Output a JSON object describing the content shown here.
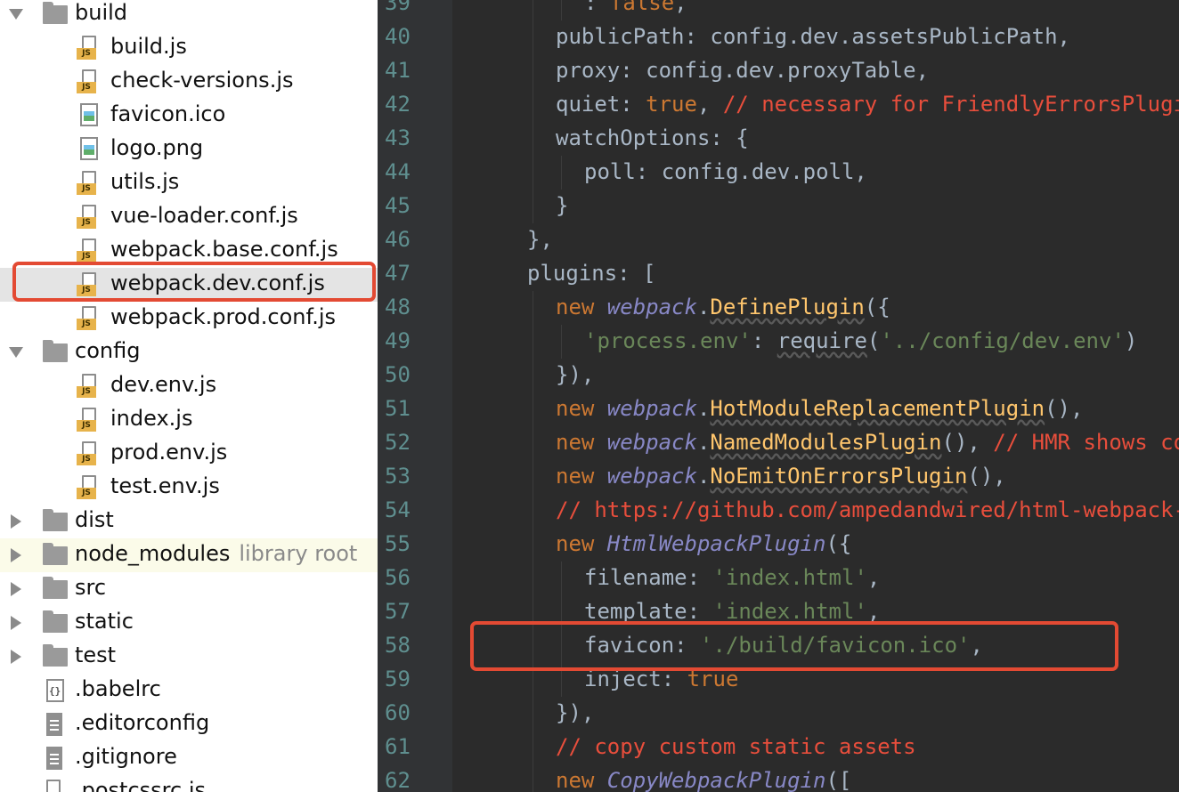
{
  "project_tree": {
    "items": [
      {
        "type": "folder",
        "label": "build",
        "expanded": true,
        "depth": 0
      },
      {
        "type": "js",
        "label": "build.js",
        "depth": 1
      },
      {
        "type": "js",
        "label": "check-versions.js",
        "depth": 1
      },
      {
        "type": "image",
        "label": "favicon.ico",
        "depth": 1
      },
      {
        "type": "image",
        "label": "logo.png",
        "depth": 1
      },
      {
        "type": "js",
        "label": "utils.js",
        "depth": 1
      },
      {
        "type": "js",
        "label": "vue-loader.conf.js",
        "depth": 1
      },
      {
        "type": "js",
        "label": "webpack.base.conf.js",
        "depth": 1
      },
      {
        "type": "js",
        "label": "webpack.dev.conf.js",
        "depth": 1,
        "selected": true
      },
      {
        "type": "js",
        "label": "webpack.prod.conf.js",
        "depth": 1
      },
      {
        "type": "folder",
        "label": "config",
        "expanded": true,
        "depth": 0
      },
      {
        "type": "js",
        "label": "dev.env.js",
        "depth": 1
      },
      {
        "type": "js",
        "label": "index.js",
        "depth": 1
      },
      {
        "type": "js",
        "label": "prod.env.js",
        "depth": 1
      },
      {
        "type": "js",
        "label": "test.env.js",
        "depth": 1
      },
      {
        "type": "folder",
        "label": "dist",
        "expanded": false,
        "depth": 0
      },
      {
        "type": "folder",
        "label": "node_modules",
        "expanded": false,
        "depth": 0,
        "suffix": "library root"
      },
      {
        "type": "folder",
        "label": "src",
        "expanded": false,
        "depth": 0
      },
      {
        "type": "folder",
        "label": "static",
        "expanded": false,
        "depth": 0
      },
      {
        "type": "folder",
        "label": "test",
        "expanded": false,
        "depth": 0
      },
      {
        "type": "config",
        "label": ".babelrc",
        "depth": 0
      },
      {
        "type": "text",
        "label": ".editorconfig",
        "depth": 0
      },
      {
        "type": "text",
        "label": ".gitignore",
        "depth": 0
      },
      {
        "type": "js",
        "label": ".postcssrc.js",
        "depth": 0
      }
    ]
  },
  "editor": {
    "lines": [
      {
        "n": "39",
        "indent": 2,
        "tokens": [
          [
            "p",
            ": "
          ],
          [
            "k",
            "false"
          ],
          [
            "p",
            ","
          ]
        ]
      },
      {
        "n": "40",
        "indent": 1,
        "tokens": [
          [
            "p",
            "publicPath: config.dev.assetsPublicPath,"
          ]
        ]
      },
      {
        "n": "41",
        "indent": 1,
        "tokens": [
          [
            "p",
            "proxy: config.dev.proxyTable,"
          ]
        ]
      },
      {
        "n": "42",
        "indent": 1,
        "tokens": [
          [
            "p",
            "quiet: "
          ],
          [
            "k",
            "true"
          ],
          [
            "p",
            ", "
          ],
          [
            "c",
            "// necessary for FriendlyErrorsPlugin"
          ]
        ]
      },
      {
        "n": "43",
        "indent": 1,
        "tokens": [
          [
            "p",
            "watchOptions: {"
          ]
        ]
      },
      {
        "n": "44",
        "indent": 2,
        "tokens": [
          [
            "p",
            "poll: config.dev.poll,"
          ]
        ]
      },
      {
        "n": "45",
        "indent": 1,
        "tokens": [
          [
            "p",
            "}"
          ]
        ]
      },
      {
        "n": "46",
        "indent": 0,
        "tokens": [
          [
            "p",
            "},"
          ]
        ]
      },
      {
        "n": "47",
        "indent": 0,
        "tokens": [
          [
            "p",
            "plugins: ["
          ]
        ]
      },
      {
        "n": "48",
        "indent": 1,
        "tokens": [
          [
            "k",
            "new "
          ],
          [
            "i",
            "webpack"
          ],
          [
            "p",
            "."
          ],
          [
            "fu",
            "DefinePlugin"
          ],
          [
            "p",
            "({"
          ]
        ]
      },
      {
        "n": "49",
        "indent": 2,
        "tokens": [
          [
            "s",
            "'process.env'"
          ],
          [
            "p",
            ": "
          ],
          [
            "pu",
            "require"
          ],
          [
            "p",
            "("
          ],
          [
            "s",
            "'../config/dev.env'"
          ],
          [
            "p",
            ")"
          ]
        ]
      },
      {
        "n": "50",
        "indent": 1,
        "tokens": [
          [
            "p",
            "}),"
          ]
        ]
      },
      {
        "n": "51",
        "indent": 1,
        "tokens": [
          [
            "k",
            "new "
          ],
          [
            "i",
            "webpack"
          ],
          [
            "p",
            "."
          ],
          [
            "fu",
            "HotModuleReplacementPlugin"
          ],
          [
            "p",
            "(),"
          ]
        ]
      },
      {
        "n": "52",
        "indent": 1,
        "tokens": [
          [
            "k",
            "new "
          ],
          [
            "i",
            "webpack"
          ],
          [
            "p",
            "."
          ],
          [
            "fu",
            "NamedModulesPlugin"
          ],
          [
            "p",
            "(), "
          ],
          [
            "c",
            "// HMR shows correct file names in console on update."
          ]
        ]
      },
      {
        "n": "53",
        "indent": 1,
        "tokens": [
          [
            "k",
            "new "
          ],
          [
            "i",
            "webpack"
          ],
          [
            "p",
            "."
          ],
          [
            "fu",
            "NoEmitOnErrorsPlugin"
          ],
          [
            "p",
            "(),"
          ]
        ]
      },
      {
        "n": "54",
        "indent": 1,
        "tokens": [
          [
            "c",
            "// https://github.com/ampedandwired/html-webpack-plugin"
          ]
        ]
      },
      {
        "n": "55",
        "indent": 1,
        "tokens": [
          [
            "k",
            "new "
          ],
          [
            "i",
            "HtmlWebpackPlugin"
          ],
          [
            "p",
            "({"
          ]
        ]
      },
      {
        "n": "56",
        "indent": 2,
        "tokens": [
          [
            "p",
            "filename: "
          ],
          [
            "s",
            "'index.html'"
          ],
          [
            "p",
            ","
          ]
        ]
      },
      {
        "n": "57",
        "indent": 2,
        "tokens": [
          [
            "p",
            "template: "
          ],
          [
            "s",
            "'index.html'"
          ],
          [
            "p",
            ","
          ]
        ]
      },
      {
        "n": "58",
        "indent": 2,
        "tokens": [
          [
            "p",
            "favicon: "
          ],
          [
            "s",
            "'./build/favicon.ico'"
          ],
          [
            "p",
            ","
          ]
        ]
      },
      {
        "n": "59",
        "indent": 2,
        "tokens": [
          [
            "p",
            "inject: "
          ],
          [
            "k",
            "true"
          ]
        ]
      },
      {
        "n": "60",
        "indent": 1,
        "tokens": [
          [
            "p",
            "}),"
          ]
        ]
      },
      {
        "n": "61",
        "indent": 1,
        "tokens": [
          [
            "c",
            "// copy custom static assets"
          ]
        ]
      },
      {
        "n": "62",
        "indent": 1,
        "tokens": [
          [
            "k",
            "new "
          ],
          [
            "i",
            "CopyWebpackPlugin"
          ],
          [
            "p",
            "(["
          ]
        ]
      }
    ]
  },
  "colors": {
    "highlight_border": "#e34a33",
    "editor_background": "#2b2b2b",
    "keyword": "#cc7832",
    "string": "#6a8759",
    "comment": "#e84e3c",
    "function": "#ffc66d"
  },
  "icons": {
    "folder": "folder-icon",
    "js": "js-file-icon",
    "image": "image-file-icon",
    "config": "config-file-icon",
    "text": "text-file-icon",
    "expand": "chevron-down-icon",
    "collapse": "chevron-right-icon"
  }
}
